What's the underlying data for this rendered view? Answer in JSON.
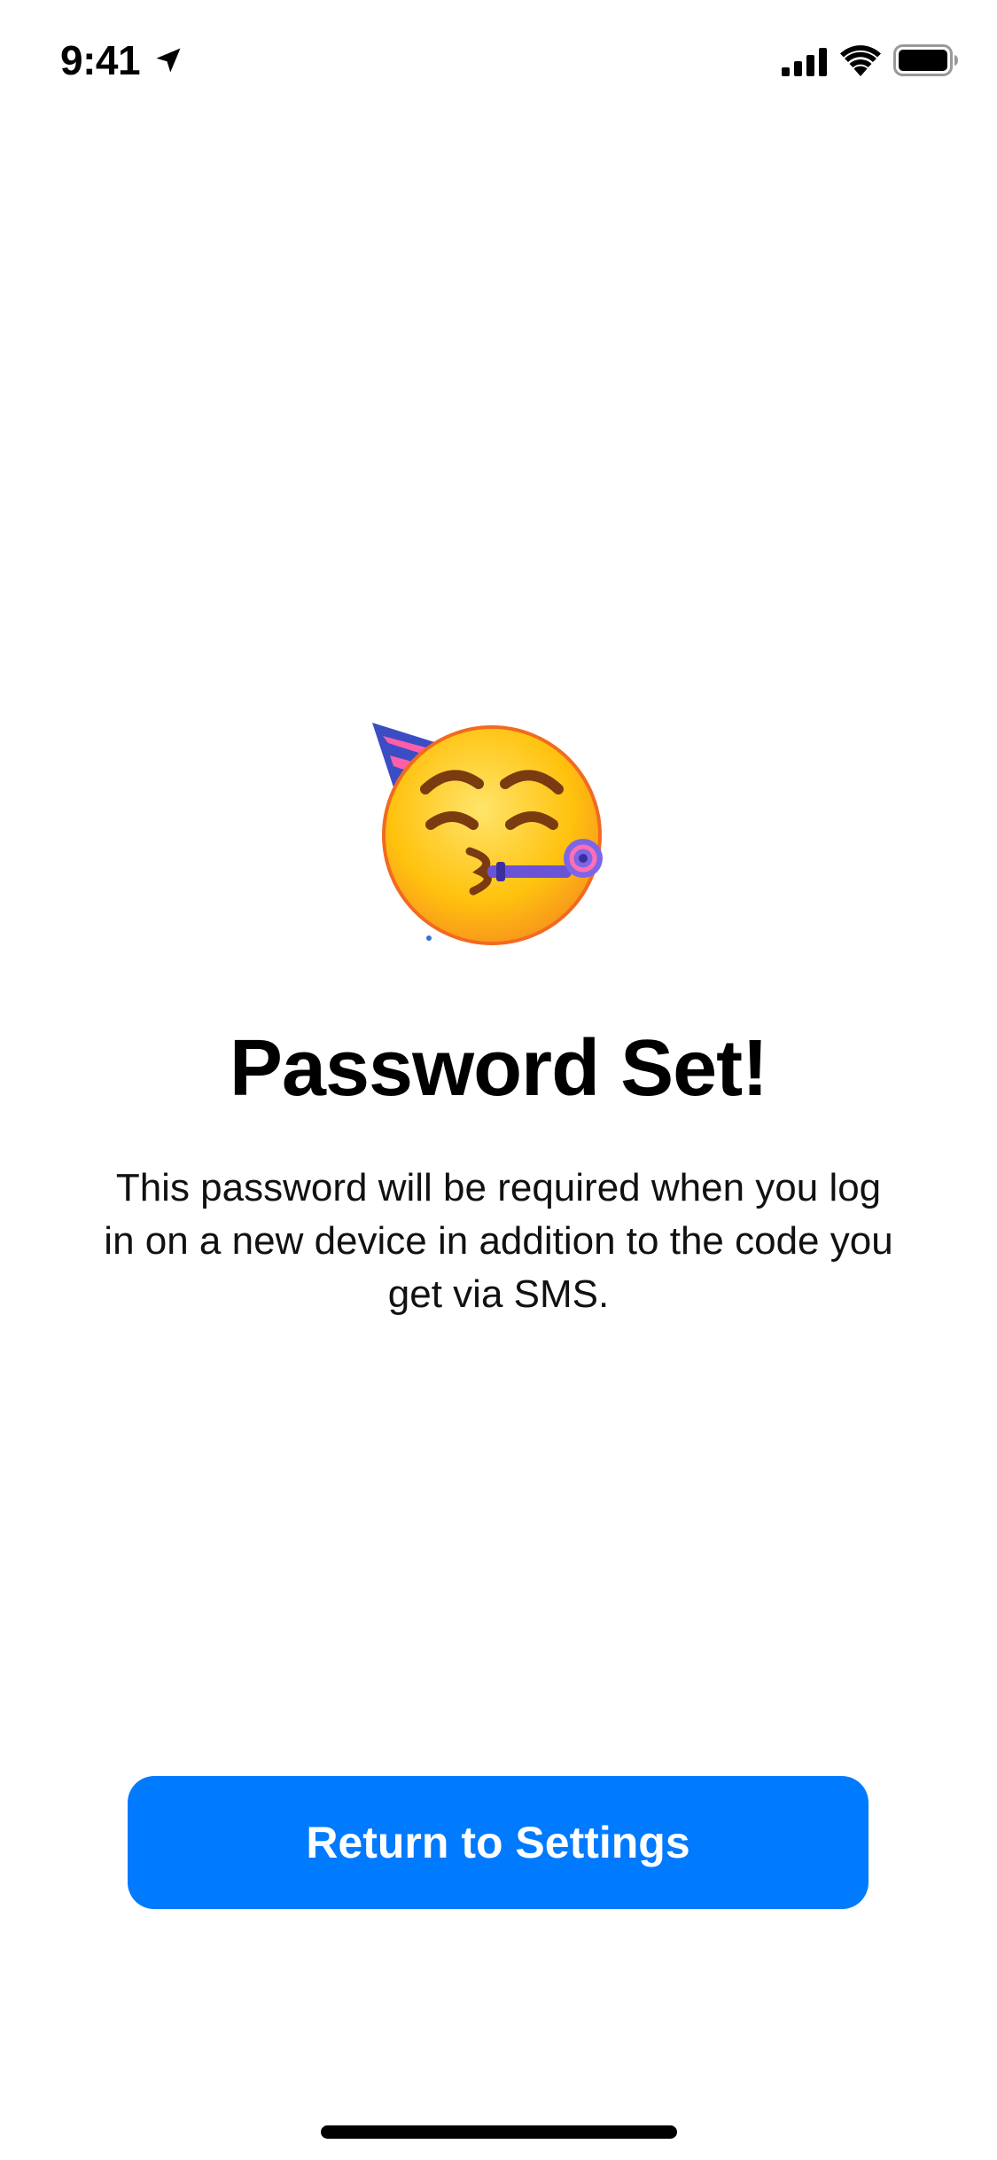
{
  "status_bar": {
    "time": "9:41",
    "icons": [
      "location-arrow-icon",
      "cellular-signal-icon",
      "wifi-icon",
      "battery-icon"
    ]
  },
  "illustration": {
    "icon": "partying-face-emoji"
  },
  "content": {
    "title": "Password Set!",
    "message": "This password will be required when you log in on a new device in addition to the code you get via SMS."
  },
  "actions": {
    "return_label": "Return to Settings"
  },
  "colors": {
    "accent": "#007aff",
    "background": "#ffffff",
    "text": "#000000"
  }
}
